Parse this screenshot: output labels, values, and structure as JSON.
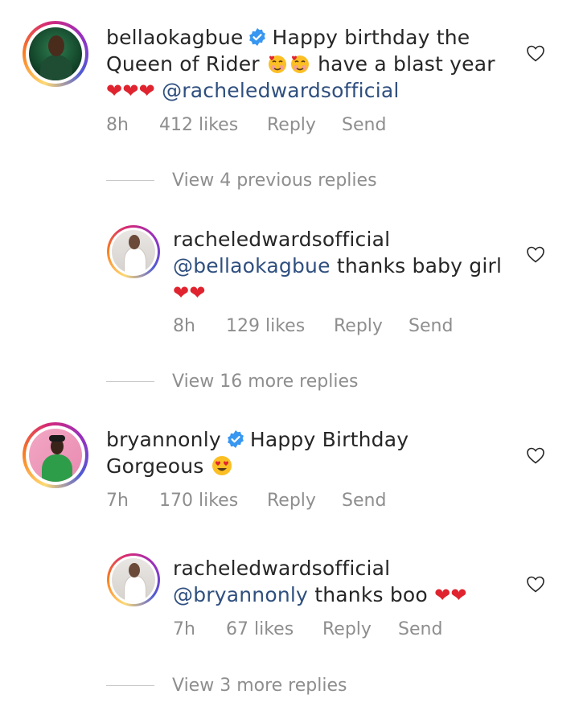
{
  "comments": [
    {
      "username": "bellaokagbue",
      "text_1": "Happy birthday the",
      "text_2": "Queen of Rider",
      "text_3": "have a blast year",
      "mention": "@racheledwardsofficial",
      "time": "8h",
      "likes": "412 likes",
      "reply": "Reply",
      "send": "Send"
    },
    {
      "username": "bryannonly",
      "text_1": "Happy Birthday",
      "text_2": "Gorgeous",
      "time": "7h",
      "likes": "170 likes",
      "reply": "Reply",
      "send": "Send"
    }
  ],
  "replies": [
    {
      "username": "racheledwardsofficial",
      "mention": "@bellaokagbue",
      "text": "thanks baby girl",
      "time": "8h",
      "likes": "129 likes",
      "reply": "Reply",
      "send": "Send"
    },
    {
      "username": "racheledwardsofficial",
      "mention": "@bryannonly",
      "text": "thanks boo",
      "time": "7h",
      "likes": "67 likes",
      "reply": "Reply",
      "send": "Send"
    }
  ],
  "view_links": [
    "View 4 previous replies",
    "View 16 more replies",
    "View 3 more replies"
  ],
  "icons": {
    "verified": "verified-badge-icon",
    "like": "heart-outline-icon",
    "heart_emoji": "red-heart-emoji",
    "smiling_hearts_emoji": "smiling-face-with-hearts-emoji",
    "heart_eyes_emoji": "heart-eyes-emoji"
  },
  "colors": {
    "mention": "#2f4f7f",
    "meta": "#8e8e8e",
    "verified": "#3897f0",
    "heart": "#e0242f"
  }
}
